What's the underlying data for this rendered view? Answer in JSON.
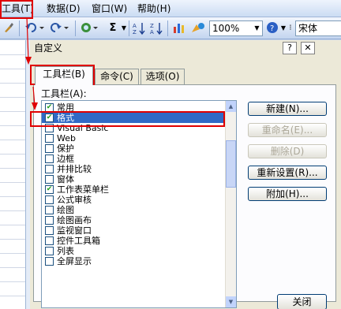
{
  "menubar": {
    "items": [
      "工具(T)",
      "数据(D)",
      "窗口(W)",
      "帮助(H)"
    ]
  },
  "toolbar": {
    "zoom": "100%",
    "font": "宋体",
    "sigma_icon": "Σ",
    "icons": [
      "paint-brush-icon",
      "undo-icon",
      "redo-icon",
      "hyperlink-icon",
      "autosum-icon",
      "sort-ascending-icon",
      "sort-descending-icon",
      "chart-wizard-icon",
      "drawing-icon",
      "help-icon"
    ]
  },
  "dialog": {
    "title": "自定义",
    "help": "?",
    "close": "✕",
    "tabs": [
      {
        "label": "工具栏(B)",
        "active": true
      },
      {
        "label": "命令(C)",
        "active": false
      },
      {
        "label": "选项(O)",
        "active": false
      }
    ],
    "list_label": "工具栏(A):",
    "toolbars": [
      {
        "label": "常用",
        "checked": true
      },
      {
        "label": "格式",
        "checked": true,
        "selected": true
      },
      {
        "label": "Visual Basic",
        "checked": false
      },
      {
        "label": "Web",
        "checked": false
      },
      {
        "label": "保护",
        "checked": false
      },
      {
        "label": "边框",
        "checked": false
      },
      {
        "label": "并排比较",
        "checked": false
      },
      {
        "label": "窗体",
        "checked": false
      },
      {
        "label": "工作表菜单栏",
        "checked": true
      },
      {
        "label": "公式审核",
        "checked": false
      },
      {
        "label": "绘图",
        "checked": false
      },
      {
        "label": "绘图画布",
        "checked": false
      },
      {
        "label": "监视窗口",
        "checked": false
      },
      {
        "label": "控件工具箱",
        "checked": false
      },
      {
        "label": "列表",
        "checked": false
      },
      {
        "label": "全屏显示",
        "checked": false
      }
    ],
    "buttons": {
      "new": "新建(N)...",
      "rename": "重命名(E)...",
      "delete": "删除(D)",
      "reset": "重新设置(R)...",
      "attach": "附加(H)..."
    },
    "close_button": "关闭"
  },
  "colors": {
    "annotation": "#e00000",
    "selection": "#316ac5"
  }
}
